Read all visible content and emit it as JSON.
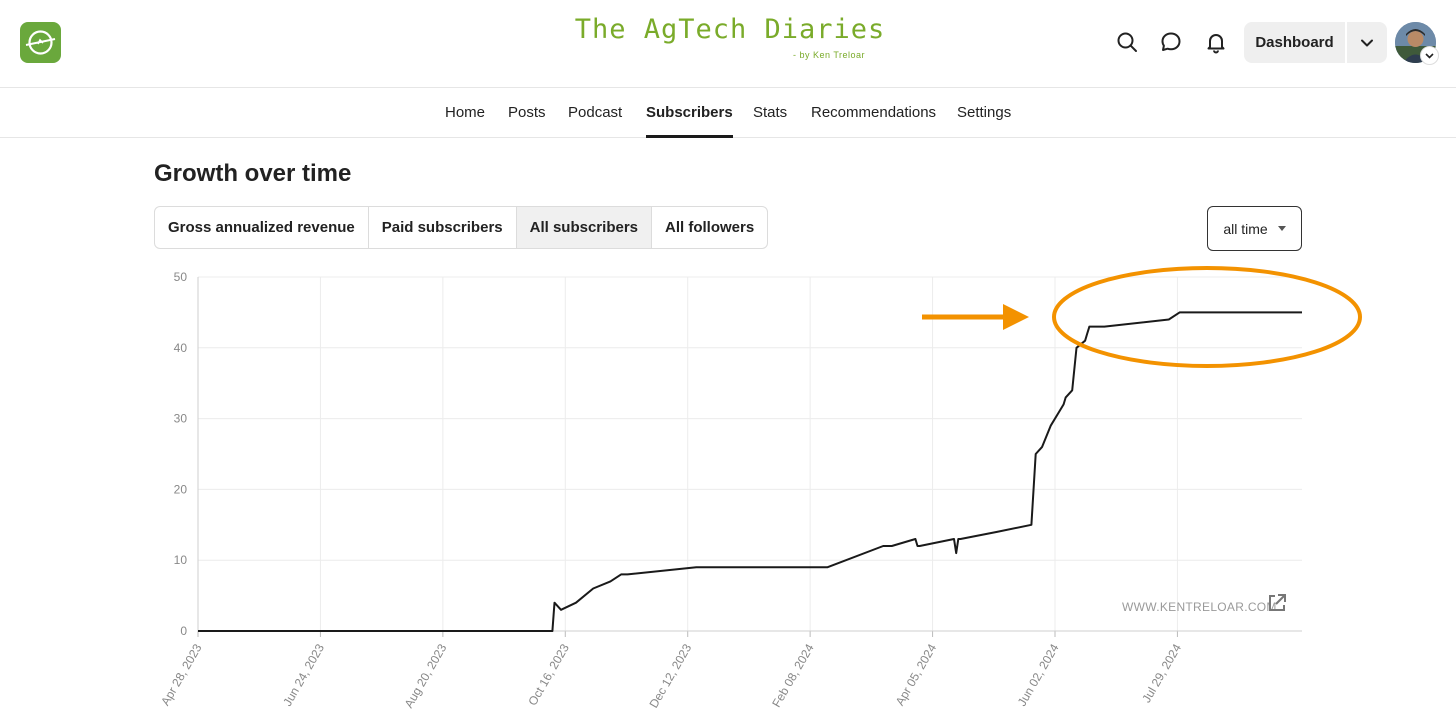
{
  "header": {
    "brand_title": "The AgTech Diaries",
    "brand_subtitle": "- by Ken Treloar",
    "dashboard_label": "Dashboard",
    "icons": [
      "search-icon",
      "chat-icon",
      "bell-icon",
      "chevron-down-icon"
    ]
  },
  "nav": {
    "items": [
      {
        "label": "Home"
      },
      {
        "label": "Posts"
      },
      {
        "label": "Podcast"
      },
      {
        "label": "Subscribers",
        "active": true
      },
      {
        "label": "Stats"
      },
      {
        "label": "Recommendations"
      },
      {
        "label": "Settings"
      }
    ]
  },
  "main": {
    "title": "Growth over time",
    "tabs": [
      {
        "label": "Gross annualized revenue"
      },
      {
        "label": "Paid subscribers"
      },
      {
        "label": "All subscribers",
        "selected": true
      },
      {
        "label": "All followers"
      }
    ],
    "range_label": "all time",
    "watermark": "WWW.KENTRELOAR.COM"
  },
  "colors": {
    "brand": "#7aab2a",
    "accent_annotation": "#f39200",
    "line": "#1a1a1a"
  },
  "chart_data": {
    "type": "line",
    "title": "",
    "xlabel": "",
    "ylabel": "",
    "ylim": [
      0,
      50
    ],
    "yticks": [
      0,
      10,
      20,
      30,
      40,
      50
    ],
    "xlim": [
      "2023-04-28",
      "2024-09-23"
    ],
    "xticks": [
      "Apr 28, 2023",
      "Jun 24, 2023",
      "Aug 20, 2023",
      "Oct 16, 2023",
      "Dec 12, 2023",
      "Feb 08, 2024",
      "Apr 05, 2024",
      "Jun 02, 2024",
      "Jul 29, 2024"
    ],
    "grid": true,
    "series": [
      {
        "x": [
          "2023-04-28",
          "2023-10-10",
          "2023-10-11",
          "2023-10-14",
          "2023-10-21",
          "2023-10-29",
          "2023-11-06",
          "2023-11-11",
          "2023-11-14",
          "2023-12-16",
          "2024-02-15",
          "2024-03-12",
          "2024-03-16",
          "2024-03-27",
          "2024-03-28",
          "2024-03-29",
          "2024-04-14",
          "2024-04-15",
          "2024-04-16",
          "2024-04-17",
          "2024-05-04",
          "2024-05-20",
          "2024-05-22",
          "2024-05-25",
          "2024-05-29",
          "2024-06-02",
          "2024-06-04",
          "2024-06-05",
          "2024-06-08",
          "2024-06-10",
          "2024-06-14",
          "2024-06-15",
          "2024-06-16",
          "2024-06-19",
          "2024-06-23",
          "2024-07-23",
          "2024-07-28",
          "2024-09-23"
        ],
        "y": [
          0,
          0,
          4,
          3,
          4,
          6,
          7,
          8,
          8,
          9,
          9,
          12,
          12,
          13,
          12,
          12,
          13,
          11,
          13,
          13,
          14,
          15,
          25,
          26,
          29,
          31,
          32,
          33,
          34,
          40,
          41,
          42,
          43,
          43,
          43,
          44,
          45,
          45
        ]
      }
    ]
  }
}
